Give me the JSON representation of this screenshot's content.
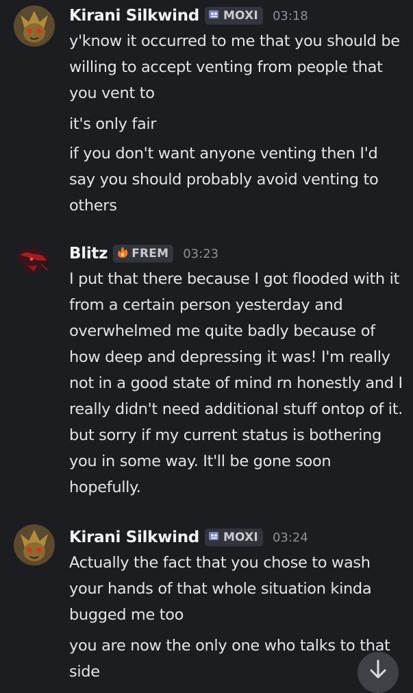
{
  "messages": [
    {
      "username": "Kirani Silkwind",
      "tag": "MOXI",
      "tag_icon": "paw-badge-icon",
      "time": "03:18",
      "lines": [
        "y'know it occurred to me that you should be willing to accept venting from people that you vent to",
        "it's only fair",
        "if you don't want anyone venting then I'd say you should probably avoid venting to others"
      ]
    },
    {
      "username": "Blitz",
      "tag": "FREM",
      "tag_icon": "flame-badge-icon",
      "time": "03:23",
      "lines": [
        "I put that there because I got flooded with it from a certain person yesterday and overwhelmed me quite badly because of how deep and depressing it was! I'm really not in a good state of mind rn honestly and I really didn't need additional  stuff ontop of it. but sorry if my current status is bothering you in some way. It'll be gone soon hopefully."
      ]
    },
    {
      "username": "Kirani Silkwind",
      "tag": "MOXI",
      "tag_icon": "paw-badge-icon",
      "time": "03:24",
      "lines": [
        "Actually the fact that you chose to wash your hands of that whole situation kinda bugged me too",
        "you are now the only one who talks to that side"
      ]
    }
  ],
  "scroll_button_icon": "arrow-down-icon",
  "colors": {
    "background": "#1c1d21",
    "username": "#f2f3f5",
    "message_text": "#e3e4e7",
    "timestamp": "#8d9097",
    "tag_bg": "#33353c",
    "scroll_button_bg": "#3f4147"
  }
}
